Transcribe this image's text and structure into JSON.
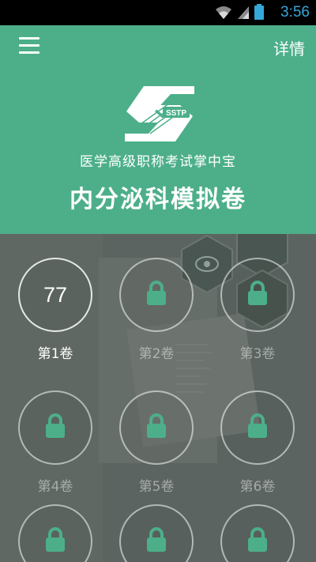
{
  "status_bar": {
    "time": "3:56",
    "icons": [
      "wifi-icon",
      "signal-icon",
      "battery-icon"
    ]
  },
  "header": {
    "menu_icon": "hamburger-menu-icon",
    "detail_label": "详情",
    "logo_text": "SSTP",
    "subtitle": "医学高级职称考试掌中宝",
    "title": "内分泌科模拟卷",
    "background_color": "#4caf8a"
  },
  "papers": [
    {
      "label": "第1卷",
      "score": "77",
      "locked": false
    },
    {
      "label": "第2卷",
      "locked": true
    },
    {
      "label": "第3卷",
      "locked": true
    },
    {
      "label": "第4卷",
      "locked": true
    },
    {
      "label": "第5卷",
      "locked": true
    },
    {
      "label": "第6卷",
      "locked": true
    },
    {
      "label": "",
      "locked": true
    },
    {
      "label": "",
      "locked": true
    },
    {
      "label": "",
      "locked": true
    }
  ],
  "colors": {
    "accent": "#4caf8a",
    "lock": "#4caf8a",
    "status_blue": "#35a7d8"
  }
}
